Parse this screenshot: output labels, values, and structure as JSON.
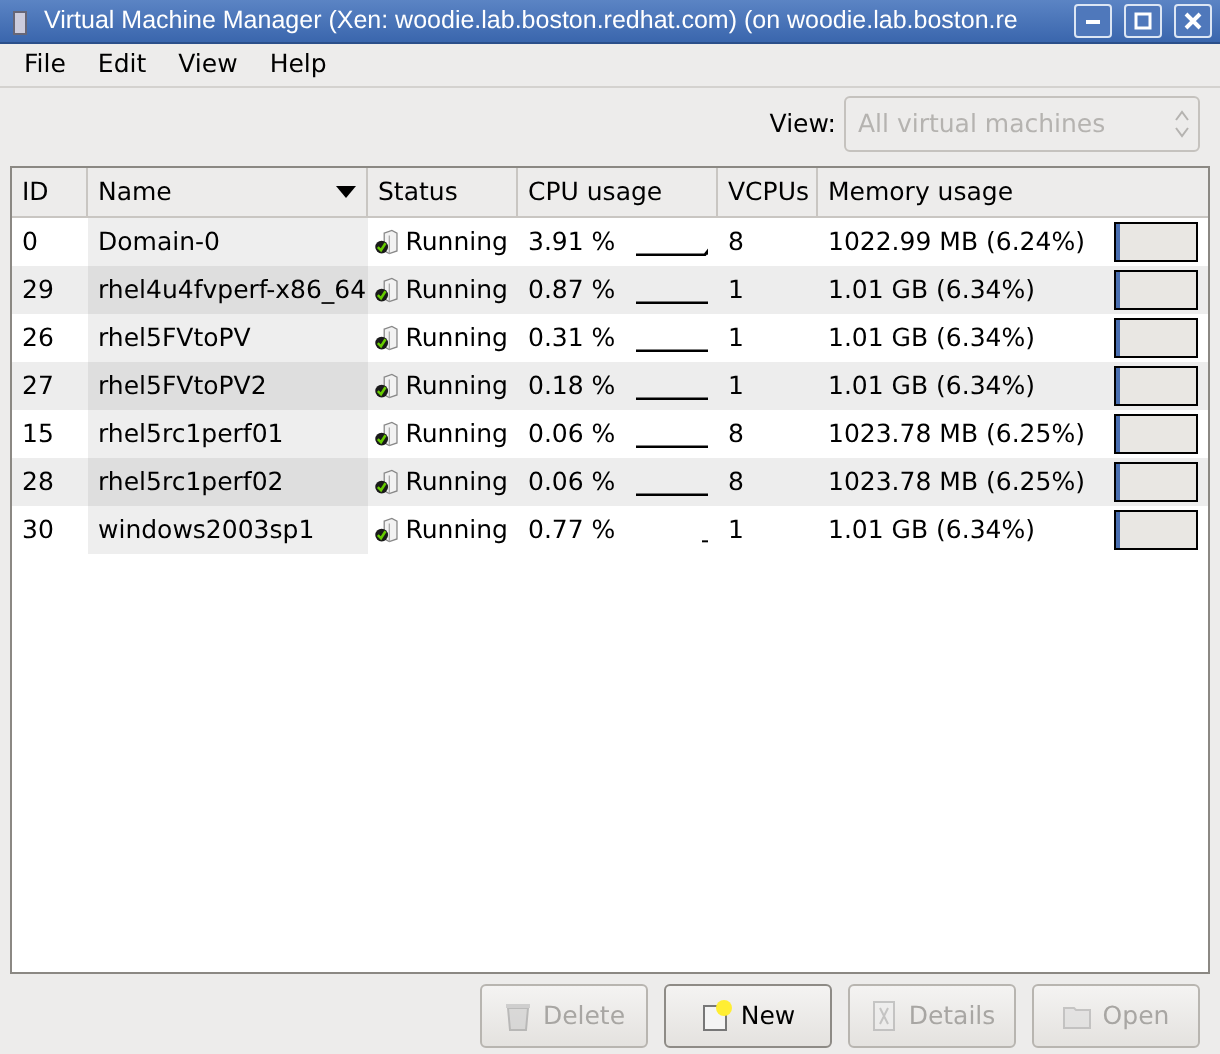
{
  "window": {
    "title": "Virtual Machine Manager (Xen: woodie.lab.boston.redhat.com) (on woodie.lab.boston.re"
  },
  "menu": [
    "File",
    "Edit",
    "View",
    "Help"
  ],
  "view_filter": {
    "label": "View:",
    "value": "All virtual machines",
    "disabled": true
  },
  "table": {
    "columns": [
      "ID",
      "Name",
      "Status",
      "CPU usage",
      "VCPUs",
      "Memory usage"
    ],
    "rows": [
      {
        "id": "0",
        "name": "Domain-0",
        "status": "Running",
        "cpu": "3.91 %",
        "vcpus": "8",
        "memory": "1022.99 MB (6.24%)",
        "level": 0.06
      },
      {
        "id": "29",
        "name": "rhel4u4fvperf-x86_64",
        "status": "Running",
        "cpu": "0.87 %",
        "vcpus": "1",
        "memory": "1.01 GB (6.34%)",
        "level": 0.06
      },
      {
        "id": "26",
        "name": "rhel5FVtoPV",
        "status": "Running",
        "cpu": "0.31 %",
        "vcpus": "1",
        "memory": "1.01 GB (6.34%)",
        "level": 0.06
      },
      {
        "id": "27",
        "name": "rhel5FVtoPV2",
        "status": "Running",
        "cpu": "0.18 %",
        "vcpus": "1",
        "memory": "1.01 GB (6.34%)",
        "level": 0.06
      },
      {
        "id": "15",
        "name": "rhel5rc1perf01",
        "status": "Running",
        "cpu": "0.06 %",
        "vcpus": "8",
        "memory": "1023.78 MB (6.25%)",
        "level": 0.06
      },
      {
        "id": "28",
        "name": "rhel5rc1perf02",
        "status": "Running",
        "cpu": "0.06 %",
        "vcpus": "8",
        "memory": "1023.78 MB (6.25%)",
        "level": 0.06
      },
      {
        "id": "30",
        "name": "windows2003sp1",
        "status": "Running",
        "cpu": "0.77 %",
        "vcpus": "1",
        "memory": "1.01 GB (6.34%)",
        "level": 0.06
      }
    ]
  },
  "buttons": [
    {
      "kind": "delete",
      "label": "Delete",
      "disabled": true
    },
    {
      "kind": "new",
      "label": "New",
      "disabled": false
    },
    {
      "kind": "details",
      "label": "Details",
      "disabled": true
    },
    {
      "kind": "open",
      "label": "Open",
      "disabled": true
    }
  ]
}
